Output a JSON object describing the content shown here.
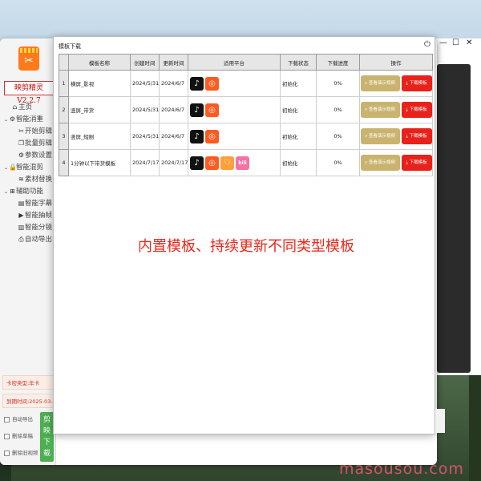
{
  "app": {
    "name": "映剪精灵V2.2.7",
    "card_type": "卡密类型:年卡",
    "expire": "到期时间:2025-03-24",
    "download_button": "剪\n映\n下\n载"
  },
  "sidebar": {
    "items": [
      {
        "label": "主页",
        "icon": "home-icon",
        "level": 0
      },
      {
        "label": "智能消重",
        "icon": "gear-icon",
        "level": 0,
        "group": true
      },
      {
        "label": "开始剪辑",
        "icon": "scissors-icon",
        "level": 1
      },
      {
        "label": "批量剪辑",
        "icon": "copy-icon",
        "level": 1
      },
      {
        "label": "参数设置",
        "icon": "settings-icon",
        "level": 1
      },
      {
        "label": "智能混剪",
        "icon": "lock-icon",
        "level": 0,
        "group": true
      },
      {
        "label": "素材替换",
        "icon": "layers-icon",
        "level": 1
      },
      {
        "label": "辅助功能",
        "icon": "grid-icon",
        "level": 0,
        "group": true
      },
      {
        "label": "智能字幕",
        "icon": "subtitle-icon",
        "level": 1
      },
      {
        "label": "智能抽帧",
        "icon": "play-icon",
        "level": 1
      },
      {
        "label": "智能分镜",
        "icon": "document-icon",
        "level": 1
      },
      {
        "label": "自动导出",
        "icon": "printer-icon",
        "level": 1
      }
    ],
    "checkboxes": [
      "自动导出",
      "删除草稿",
      "删除旧视频"
    ]
  },
  "dialog": {
    "title": "模板下载",
    "columns": [
      "模板名称",
      "创建时间",
      "更新时间",
      "适用平台",
      "下载状态",
      "下载进度",
      "操作"
    ],
    "rows": [
      {
        "idx": "1",
        "name": "横屏_影视",
        "created": "2024/5/31",
        "updated": "2024/6/7",
        "platforms": [
          "tiktok",
          "kuaishou"
        ],
        "status": "初始化",
        "progress": "0%"
      },
      {
        "idx": "2",
        "name": "竖屏_带货",
        "created": "2024/5/31",
        "updated": "2024/6/7",
        "platforms": [
          "tiktok",
          "kuaishou"
        ],
        "status": "初始化",
        "progress": "0%"
      },
      {
        "idx": "3",
        "name": "竖屏_短剧",
        "created": "2024/5/31",
        "updated": "2024/6/7",
        "platforms": [
          "tiktok",
          "kuaishou"
        ],
        "status": "初始化",
        "progress": "0%"
      },
      {
        "idx": "4",
        "name": "1分钟以下带货模板",
        "created": "2024/7/17",
        "updated": "2024/7/17",
        "platforms": [
          "tiktok",
          "kuaishou",
          "xiaohongshu",
          "bilibili"
        ],
        "status": "初始化",
        "progress": "0%"
      }
    ],
    "preview_label": "查看演示视频",
    "download_label": "下载模板"
  },
  "overlay": "内置模板、持续更新不同类型模板",
  "watermark": "masousou.com",
  "colors": {
    "accent_red": "#e8211b",
    "preview_gold": "#c9b36e",
    "green_download": "#4caf50"
  }
}
